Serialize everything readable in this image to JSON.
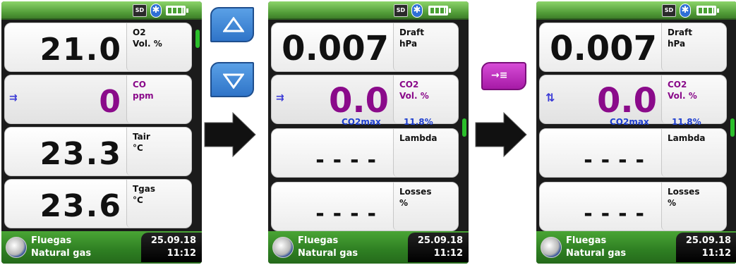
{
  "status_icons": {
    "sd_label": "SD",
    "bluetooth_glyph": "✱"
  },
  "screens": [
    {
      "panels": [
        {
          "value": "21.0",
          "label1": "O2",
          "label2": "Vol. %",
          "purple": false
        },
        {
          "value": "0",
          "label1": "CO",
          "label2": "ppm",
          "purple": true,
          "marker": "⇉"
        },
        {
          "value": "23.3",
          "label1": "Tair",
          "label2": "°C",
          "purple": false
        },
        {
          "value": "23.6",
          "label1": "Tgas",
          "label2": "°C",
          "purple": false
        }
      ],
      "bottom": {
        "title": "Fluegas",
        "subtitle": "Natural gas",
        "date": "25.09.18",
        "time": "11:12"
      }
    },
    {
      "panels": [
        {
          "value": "0.007",
          "label1": "Draft",
          "label2": "hPa"
        },
        {
          "value": "0.0",
          "label1": "CO2",
          "label2": "Vol. %",
          "purple": true,
          "marker": "⇉"
        },
        {
          "value": "----",
          "label1": "Lambda",
          "label2": ""
        },
        {
          "value": "----",
          "label1": "Losses",
          "label2": "%"
        }
      ],
      "info": {
        "name": "CO2max",
        "value": "11.8%"
      },
      "bottom": {
        "title": "Fluegas",
        "subtitle": "Natural gas",
        "date": "25.09.18",
        "time": "11:12"
      }
    },
    {
      "panels": [
        {
          "value": "0.007",
          "label1": "Draft",
          "label2": "hPa"
        },
        {
          "value": "0.0",
          "label1": "CO2",
          "label2": "Vol. %",
          "purple": true,
          "marker": "⇅"
        },
        {
          "value": "----",
          "label1": "Lambda",
          "label2": ""
        },
        {
          "value": "----",
          "label1": "Losses",
          "label2": "%"
        }
      ],
      "info": {
        "name": "CO2max",
        "value": "11.8%"
      },
      "bottom": {
        "title": "Fluegas",
        "subtitle": "Natural gas",
        "date": "25.09.18",
        "time": "11:12"
      }
    }
  ],
  "keys": {
    "up_icon": "triangle-up-icon",
    "down_icon": "triangle-down-icon",
    "swap_glyph": "→≡"
  },
  "colors": {
    "accent_green": "#4f9a36",
    "purple": "#8a0a8a",
    "blue": "#1f3fcf"
  }
}
